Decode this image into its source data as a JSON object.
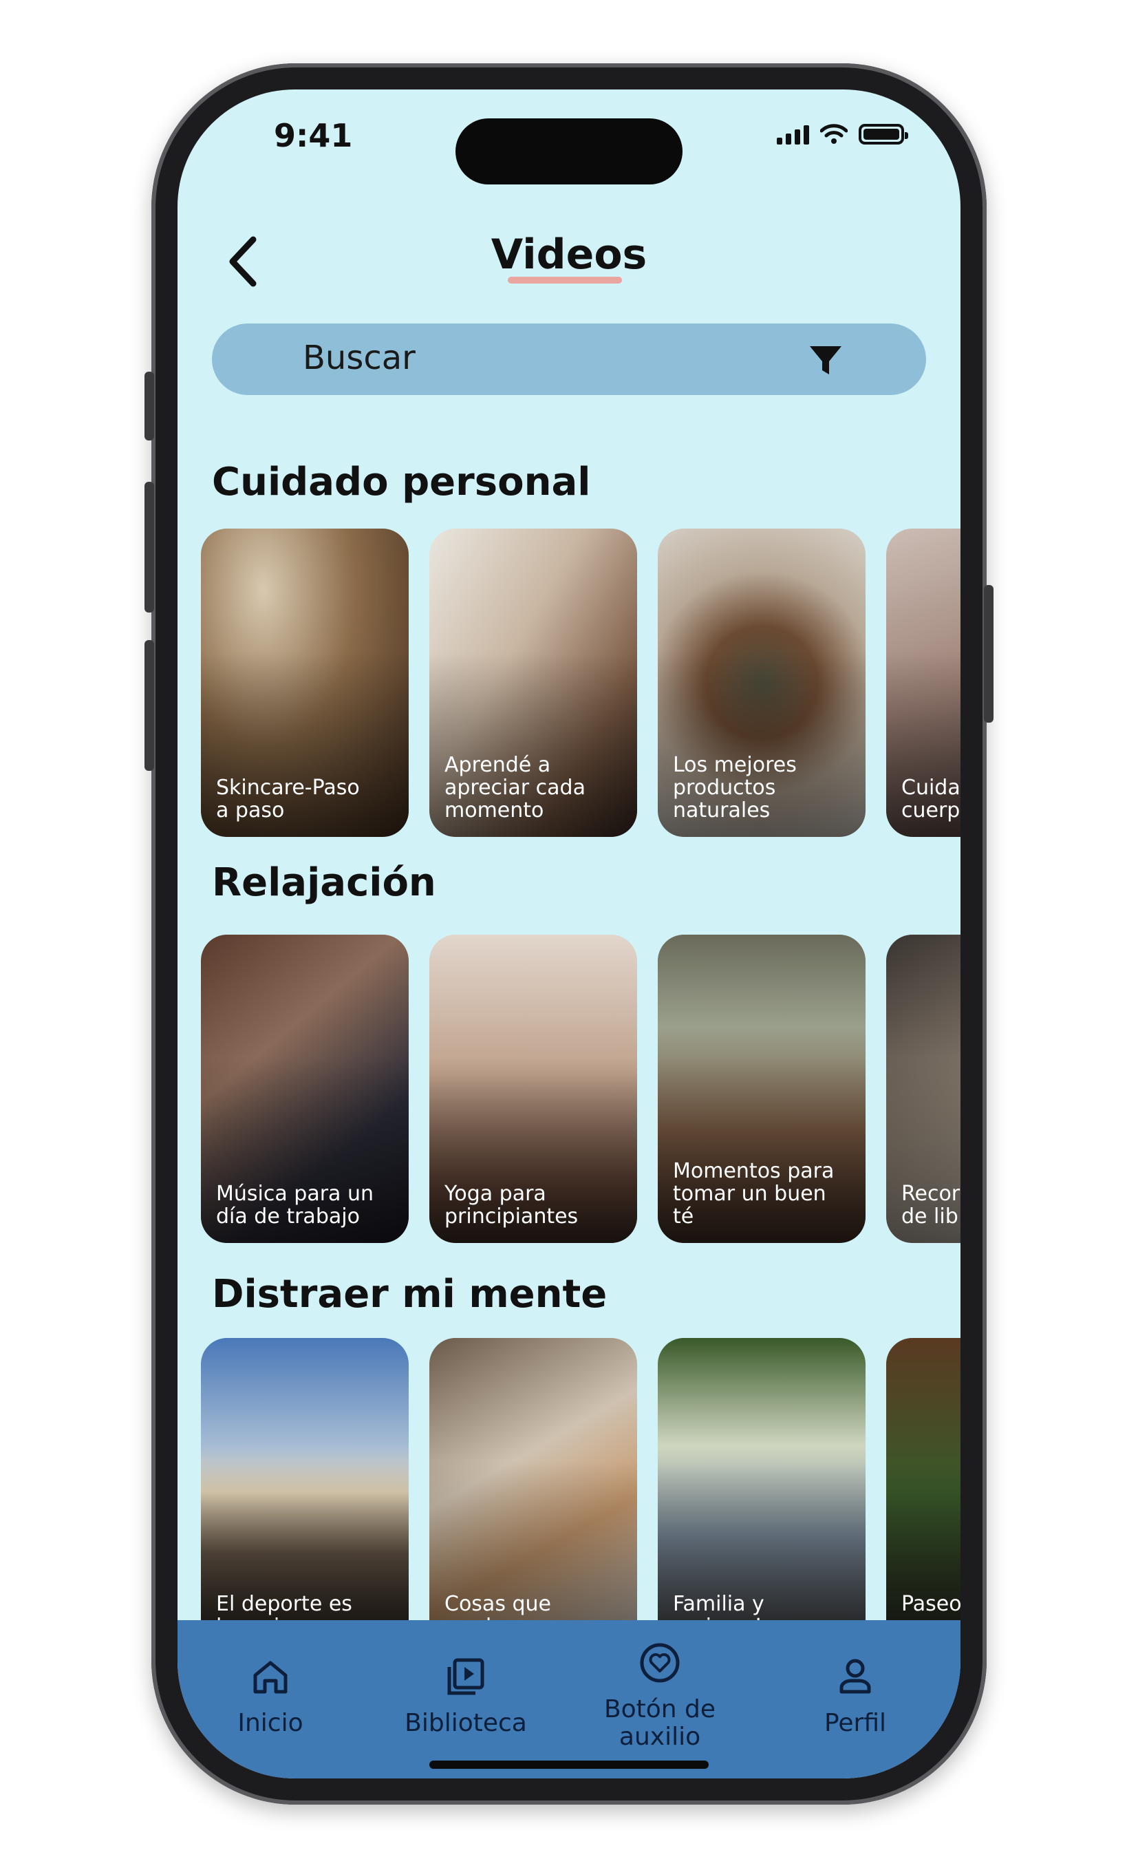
{
  "status_bar": {
    "time": "9:41"
  },
  "header": {
    "title": "Videos",
    "back_icon": "chevron-left-icon"
  },
  "search": {
    "placeholder": "Buscar",
    "filter_icon": "filter-icon"
  },
  "sections": [
    {
      "title": "Cuidado personal",
      "cards": [
        {
          "label": "Skincare-Paso\na paso"
        },
        {
          "label": "Aprendé a\napreciar cada\nmomento"
        },
        {
          "label": "Los mejores\nproductos\nnaturales"
        },
        {
          "label": "Cuida\ncuerp"
        }
      ]
    },
    {
      "title": "Relajación",
      "cards": [
        {
          "label": "Música para un\ndía de trabajo"
        },
        {
          "label": "Yoga para\nprincipiantes"
        },
        {
          "label": "Momentos para\ntomar un buen\nté"
        },
        {
          "label": "Recor\nde lib"
        }
      ]
    },
    {
      "title": "Distraer mi mente",
      "cards": [
        {
          "label": "El deporte es\nla mejor\ndisciplina"
        },
        {
          "label": "Cosas que\nproducen\nansiedad"
        },
        {
          "label": "Familia y\namigos-La\nimportancia de"
        },
        {
          "label": "Paseo"
        }
      ]
    }
  ],
  "tab_bar": {
    "items": [
      {
        "label": "Inicio",
        "icon": "home-icon"
      },
      {
        "label": "Biblioteca",
        "icon": "library-icon"
      },
      {
        "label": "Botón de\nauxilio",
        "icon": "heart-help-icon"
      },
      {
        "label": "Perfil",
        "icon": "user-icon"
      }
    ]
  },
  "colors": {
    "screen_bg": "#d1f3f8",
    "search_bg": "#8fbfd8",
    "tab_bar_bg": "#3f7ab5",
    "title_underline": "#e8a69f"
  }
}
